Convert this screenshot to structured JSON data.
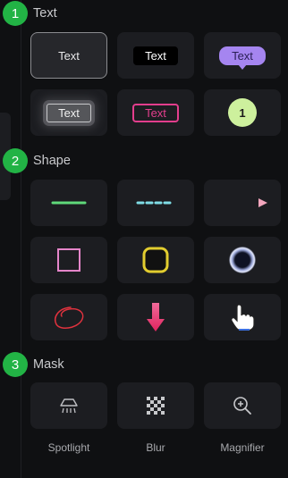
{
  "sections": {
    "text": {
      "number": "1",
      "title": "Text"
    },
    "shape": {
      "number": "2",
      "title": "Shape"
    },
    "mask": {
      "number": "3",
      "title": "Mask"
    }
  },
  "text_styles": {
    "plain": "Text",
    "black_box": "Text",
    "bubble": "Text",
    "blurred_box": "Text",
    "pink_outline": "Text",
    "number_badge": "1"
  },
  "shape_items": [
    "green-line",
    "cyan-dashed-line",
    "pink-arrow",
    "pink-square",
    "yellow-rounded-square",
    "glow-circle",
    "red-freehand-circle",
    "pink-down-arrow",
    "pointing-hand"
  ],
  "mask_items": [
    {
      "label": "Spotlight",
      "icon": "spotlight-icon"
    },
    {
      "label": "Blur",
      "icon": "checker-icon"
    },
    {
      "label": "Magnifier",
      "icon": "magnifier-icon"
    }
  ],
  "colors": {
    "background": "#0f1012",
    "tile": "#1c1d21",
    "step_badge": "#22b345",
    "bubble": "#a585f0",
    "pink": "#e33e8d",
    "number_badge": "#cdf09d"
  }
}
